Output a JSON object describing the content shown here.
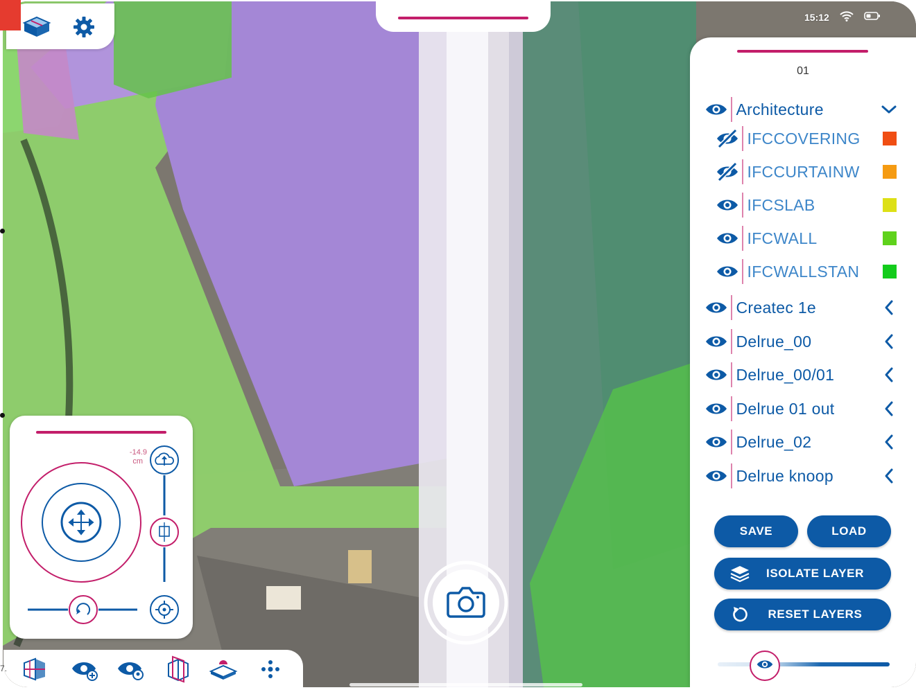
{
  "status_bar": {
    "time": "15:12",
    "wifi_icon": "wifi-icon",
    "battery_icon": "battery-icon"
  },
  "top_left": {
    "model_icon": "3d-model-icon",
    "settings_icon": "gear-icon"
  },
  "layer_panel": {
    "level": "01",
    "groups": [
      {
        "label": "Architecture",
        "visible": true,
        "expanded": true
      },
      {
        "label": "Createc 1e",
        "visible": true,
        "expanded": false
      },
      {
        "label": "Delrue_00",
        "visible": true,
        "expanded": false
      },
      {
        "label": "Delrue_00/01",
        "visible": true,
        "expanded": false
      },
      {
        "label": "Delrue 01 out",
        "visible": true,
        "expanded": false
      },
      {
        "label": "Delrue_02",
        "visible": true,
        "expanded": false
      },
      {
        "label": "Delrue knoop",
        "visible": true,
        "expanded": false
      }
    ],
    "sublayers": [
      {
        "label": "IFCCOVERING",
        "visible": false,
        "color": "#f04e13"
      },
      {
        "label": "IFCCURTAINW",
        "visible": false,
        "color": "#f59b12"
      },
      {
        "label": "IFCSLAB",
        "visible": true,
        "color": "#dde016"
      },
      {
        "label": "IFCWALL",
        "visible": true,
        "color": "#5fd21c"
      },
      {
        "label": "IFCWALLSTAN",
        "visible": true,
        "color": "#13cc1c"
      }
    ],
    "buttons": {
      "save": "SAVE",
      "load": "LOAD",
      "isolate": "ISOLATE LAYER",
      "reset": "RESET LAYERS"
    },
    "opacity_slider": {
      "value": 0.28
    }
  },
  "transform_panel": {
    "offset_value": "-14.9",
    "offset_unit": "cm"
  },
  "bottom_toolbar": {
    "icons": [
      "section-box-icon",
      "add-view-icon",
      "locate-view-icon",
      "clip-plane-icon",
      "floor-plane-icon",
      "move-dots-icon"
    ]
  },
  "edge_text": "7.",
  "colors": {
    "accent": "#c31e6a",
    "primary": "#0d5aa6"
  }
}
